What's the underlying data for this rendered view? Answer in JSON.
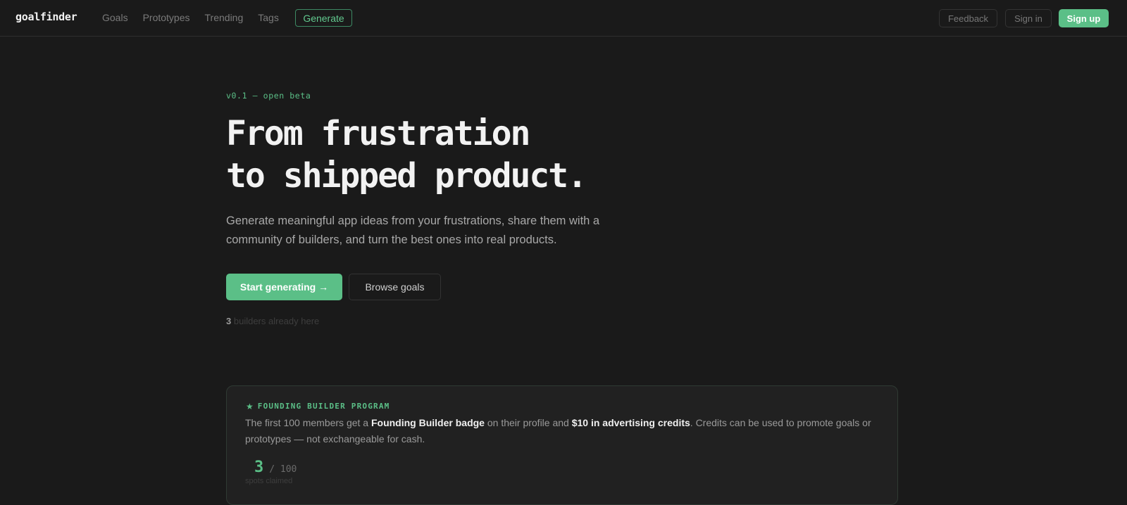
{
  "nav": {
    "brand": "goalfinder",
    "links": [
      "Goals",
      "Prototypes",
      "Trending",
      "Tags"
    ],
    "generate": "Generate",
    "feedback": "Feedback",
    "sign_in": "Sign in",
    "sign_up": "Sign up"
  },
  "hero": {
    "version": "v0.1 — open beta",
    "headline_line1": "From frustration",
    "headline_line2": "to shipped product.",
    "subtitle": "Generate meaningful app ideas from your frustrations, share them with a community of builders, and turn the best ones into real products.",
    "primary_button": "Start generating →",
    "secondary_button": "Browse goals",
    "builders_count": "3",
    "builders_text": "builders already here"
  },
  "program": {
    "title": "FOUNDING BUILDER PROGRAM",
    "desc_part1": "The first 100 members get a ",
    "desc_bold1": "Founding Builder badge",
    "desc_part2": " on their profile and ",
    "desc_bold2": "$10 in advertising credits",
    "desc_part3": ". Credits can be used to promote goals or prototypes — not exchangeable for cash.",
    "spots_claimed": "3",
    "spots_total": "/ 100",
    "spots_label": "spots claimed"
  },
  "colors": {
    "accent": "#5bbf87",
    "background": "#1a1a1a"
  },
  "icons": {
    "program": "star-icon"
  }
}
